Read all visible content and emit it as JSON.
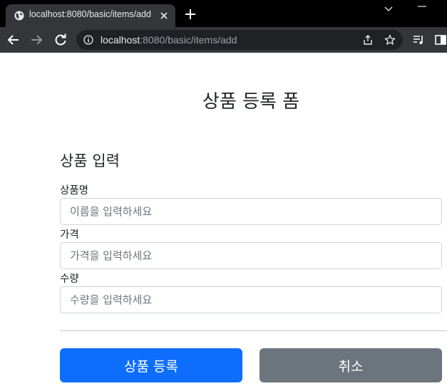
{
  "browser": {
    "tab_title": "localhost:8080/basic/items/add",
    "url_host": "localhost",
    "url_path": ":8080/basic/items/add"
  },
  "page": {
    "title": "상품 등록 폼",
    "section_title": "상품 입력"
  },
  "form": {
    "fields": [
      {
        "label": "상품명",
        "placeholder": "이름을 입력하세요",
        "value": ""
      },
      {
        "label": "가격",
        "placeholder": "가격을 입력하세요",
        "value": ""
      },
      {
        "label": "수량",
        "placeholder": "수량을 입력하세요",
        "value": ""
      }
    ],
    "submit_label": "상품 등록",
    "cancel_label": "취소"
  },
  "colors": {
    "primary": "#0d6efd",
    "secondary": "#6c757d",
    "chrome_dark": "#35363a"
  },
  "icons": {
    "tab_favicon": "globe-icon",
    "tab_close": "close-icon",
    "new_tab": "plus-icon",
    "back": "arrow-left-icon",
    "forward": "arrow-right-icon",
    "reload": "reload-icon",
    "site_info": "info-icon",
    "share": "share-icon",
    "bookmark": "star-icon",
    "media": "media-queue-icon",
    "side_panel": "side-panel-icon"
  }
}
